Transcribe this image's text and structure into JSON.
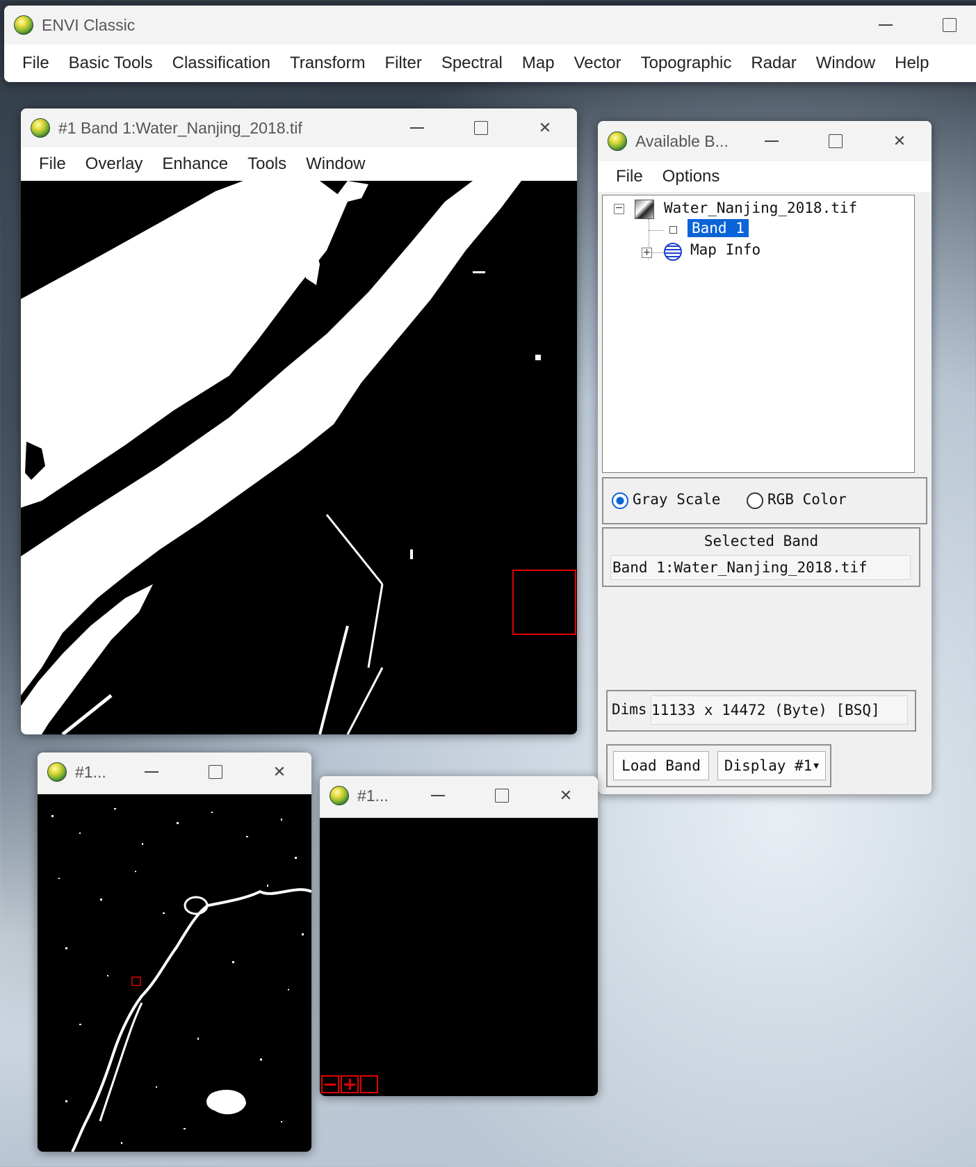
{
  "main_window": {
    "title": "ENVI Classic",
    "menu": [
      "File",
      "Basic Tools",
      "Classification",
      "Transform",
      "Filter",
      "Spectral",
      "Map",
      "Vector",
      "Topographic",
      "Radar",
      "Window",
      "Help"
    ]
  },
  "image_window": {
    "title": "#1 Band 1:Water_Nanjing_2018.tif",
    "menu": [
      "File",
      "Overlay",
      "Enhance",
      "Tools",
      "Window"
    ]
  },
  "available_bands": {
    "title": "Available B...",
    "menu": [
      "File",
      "Options"
    ],
    "tree": {
      "file": "Water_Nanjing_2018.tif",
      "band": "Band 1",
      "map_info": "Map Info"
    },
    "mode_options": [
      "Gray Scale",
      "RGB Color"
    ],
    "selected_mode": "Gray Scale",
    "selected_band_label": "Selected Band",
    "selected_band_value": "Band 1:Water_Nanjing_2018.tif",
    "dims_label": "Dims",
    "dims_value": "11133 x 14472 (Byte) [BSQ]",
    "load_button": "Load Band",
    "display_select": "Display #1"
  },
  "scroll_window": {
    "title": "#1..."
  },
  "zoom_window": {
    "title": "#1..."
  },
  "colors": {
    "selection": "#0a64d8",
    "roi_box": "#e00000"
  },
  "icons": [
    "envi-globe-icon",
    "minimize-icon",
    "maximize-icon",
    "close-icon",
    "tree-collapse-icon",
    "tree-expand-icon",
    "image-file-icon",
    "globe-grid-icon",
    "dropdown-arrow-icon"
  ]
}
